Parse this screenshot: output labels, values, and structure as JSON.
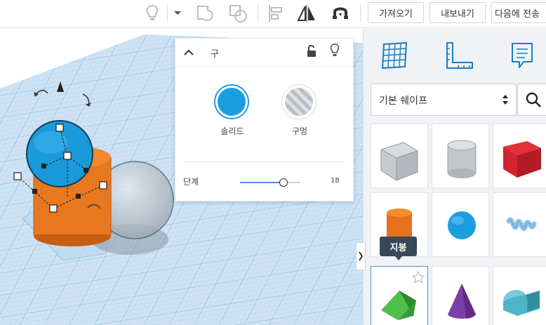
{
  "toolbar": {
    "import_label": "가져오기",
    "export_label": "내보내기",
    "send_label": "다음에 전송",
    "icons": [
      "lightbulb-icon",
      "dropdown-caret-icon",
      "group-icon",
      "ungroup-icon",
      "align-icon",
      "mirror-icon",
      "magnet-icon"
    ]
  },
  "inspector": {
    "title": "구",
    "solid_label": "솔리드",
    "hole_label": "구멍",
    "steps_label": "단계",
    "steps_value": "18",
    "steps_fraction": 0.72,
    "solid_color": "#1b9ee0",
    "icons": [
      "collapse-chevron-icon",
      "lock-open-icon",
      "lightbulb-icon"
    ]
  },
  "sidepanel": {
    "icons": [
      "workplane-grid-icon",
      "ruler-icon",
      "notes-icon"
    ],
    "library_label": "기본 쉐이프",
    "tooltip": "지붕",
    "shapes": [
      {
        "name": "box-hole",
        "color": "#b8bcc2"
      },
      {
        "name": "cylinder-hole",
        "color": "#b8bcc2"
      },
      {
        "name": "box",
        "color": "#d3232e"
      },
      {
        "name": "cylinder",
        "color": "#e8711d"
      },
      {
        "name": "sphere",
        "color": "#1b9ee0"
      },
      {
        "name": "scribble",
        "color": "#8fc5e8"
      },
      {
        "name": "roof",
        "color": "#3aa43b"
      },
      {
        "name": "cone",
        "color": "#7b3fa5"
      },
      {
        "name": "round-roof",
        "color": "#4fb4c7"
      }
    ]
  }
}
